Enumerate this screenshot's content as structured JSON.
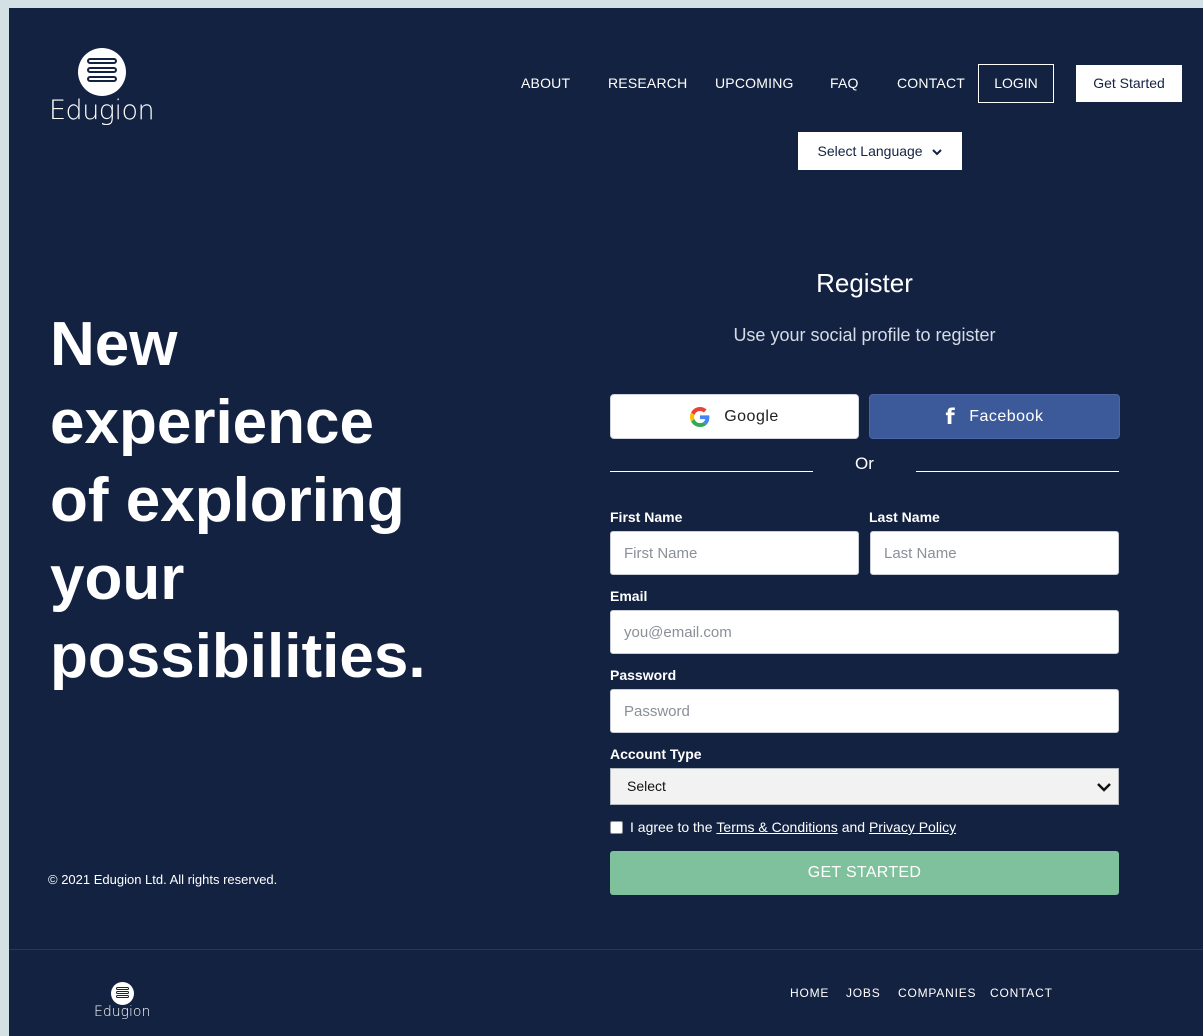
{
  "brand": {
    "name": "Edugion"
  },
  "nav": {
    "items": [
      "ABOUT",
      "RESEARCH",
      "UPCOMING",
      "FAQ",
      "CONTACT"
    ],
    "login_label": "LOGIN",
    "get_started_label": "Get Started",
    "language_label": "Select Language"
  },
  "hero": {
    "lines": [
      "New",
      "experience",
      "of exploring",
      "your",
      "possibilities."
    ]
  },
  "copyright": "© 2021 Edugion Ltd. All rights reserved.",
  "register": {
    "title": "Register",
    "subtitle": "Use your social profile to register",
    "google_label": "Google",
    "facebook_label": "Facebook",
    "or_label": "Or",
    "first_name": {
      "label": "First Name",
      "placeholder": "First Name"
    },
    "last_name": {
      "label": "Last Name",
      "placeholder": "Last Name"
    },
    "email": {
      "label": "Email",
      "placeholder": "you@email.com"
    },
    "password": {
      "label": "Password",
      "placeholder": "Password"
    },
    "account_type": {
      "label": "Account Type",
      "selected": "Select"
    },
    "agree": {
      "prefix": "I agree to the",
      "terms": "Terms & Conditions",
      "and": "and",
      "privacy": "Privacy Policy"
    },
    "submit_label": "GET STARTED"
  },
  "footer": {
    "nav": [
      "HOME",
      "JOBS",
      "COMPANIES",
      "CONTACT"
    ]
  },
  "colors": {
    "background": "#132241",
    "outer": "#d4e1e4",
    "facebook": "#3c5a99",
    "submit": "#80c19d"
  }
}
